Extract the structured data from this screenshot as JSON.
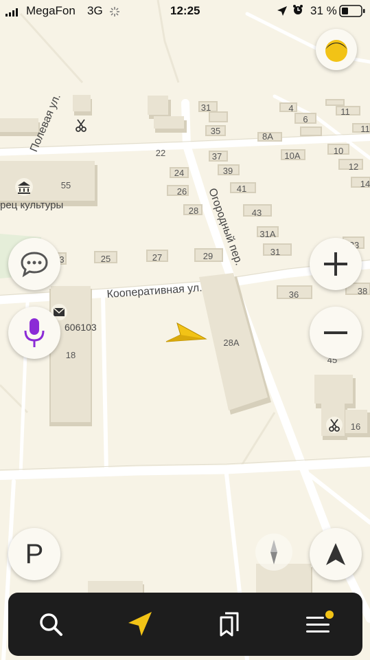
{
  "status_bar": {
    "carrier": "MegaFon",
    "network": "3G",
    "time": "12:25",
    "battery": "31 %"
  },
  "streets": {
    "poleva": "Полевая ул.",
    "kooperativnaya": "Кооперативная ул.",
    "ogorodny": "Огородный пер."
  },
  "poi": {
    "culture_house": "рец культуры",
    "post_office": "606103"
  },
  "house_numbers": {
    "h55": "55",
    "h31_top": "31",
    "h35": "35",
    "h4": "4",
    "h6": "6",
    "h8a": "8А",
    "h11": "11",
    "h22": "22",
    "h37": "37",
    "h10a": "10А",
    "h10": "10",
    "h12": "12",
    "h14": "14",
    "h24": "24",
    "h39": "39",
    "h26": "26",
    "h41": "41",
    "h28": "28",
    "h43": "43",
    "h31a": "31А",
    "h31": "31",
    "h3": "3",
    "h25": "25",
    "h27": "27",
    "h29": "29",
    "h33": "33",
    "h36": "36",
    "h38": "38",
    "h18": "18",
    "h28a": "28А",
    "h45": "45",
    "h16": "16",
    "h11b": "11"
  },
  "controls": {
    "parking_label": "P",
    "zoom_in": "+"
  },
  "colors": {
    "map_bg": "#f7f3e6",
    "road": "#ffffff",
    "building": "#e9e3d2",
    "building_side": "#d6cfbb",
    "accent_yellow": "#f2c316",
    "alice_purple": "#8b2bd6",
    "dark_bar": "#1d1d1d"
  },
  "icons": {
    "alice": "alice-logo",
    "chat": "chat-bubble-icon",
    "voice": "microphone-icon",
    "zoom_out": "minus-icon",
    "compass": "compass-icon",
    "location": "north-arrow-icon",
    "search": "search-icon",
    "navigator": "navigator-arrow-icon",
    "bookmarks": "bookmarks-icon",
    "menu": "menu-icon",
    "position": "user-position-arrow-icon"
  }
}
